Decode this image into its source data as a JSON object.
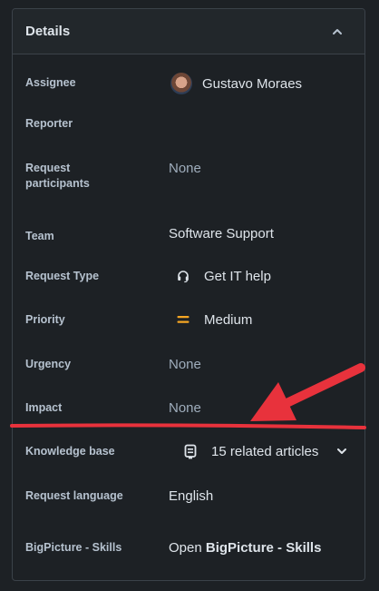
{
  "panel": {
    "title": "Details",
    "collapse_icon": "chevron-up-icon"
  },
  "fields": {
    "assignee": {
      "label": "Assignee",
      "value": "Gustavo Moraes"
    },
    "reporter": {
      "label": "Reporter",
      "value": ""
    },
    "request_participants": {
      "label": "Request participants",
      "value": "None"
    },
    "team": {
      "label": "Team",
      "value": "Software Support"
    },
    "request_type": {
      "label": "Request Type",
      "value": "Get IT help",
      "icon": "headset-icon"
    },
    "priority": {
      "label": "Priority",
      "value": "Medium",
      "icon": "priority-medium-icon",
      "icon_color": "#f5a623"
    },
    "urgency": {
      "label": "Urgency",
      "value": "None"
    },
    "impact": {
      "label": "Impact",
      "value": "None"
    },
    "knowledge_base": {
      "label": "Knowledge base",
      "value": "15 related articles",
      "icon": "article-icon"
    },
    "request_language": {
      "label": "Request language",
      "value": "English"
    },
    "bigpicture_skills": {
      "label": "BigPicture - Skills",
      "value_prefix": "Open ",
      "value_bold": "BigPicture - Skills"
    }
  },
  "annotation": {
    "color": "#e8323c"
  }
}
